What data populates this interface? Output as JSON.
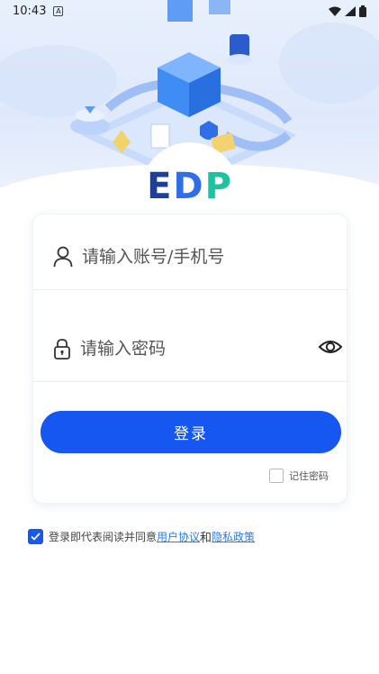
{
  "status_bar": {
    "time": "10:43",
    "notification_badge": "A"
  },
  "logo": {
    "e": "E",
    "d": "D",
    "p": "P"
  },
  "login_form": {
    "username_placeholder": "请输入账号/手机号",
    "password_placeholder": "请输入密码",
    "login_label": "登录",
    "remember_label": "记住密码"
  },
  "agreement": {
    "prefix": "登录即代表阅读并同意",
    "user_agreement": "用户协议",
    "and": "和",
    "privacy_policy": "隐私政策"
  },
  "colors": {
    "accent": "#1557f0",
    "link": "#2d7be5"
  },
  "icons": [
    "user-icon",
    "lock-icon",
    "eye-icon",
    "wifi-icon",
    "signal-icon",
    "battery-icon",
    "check-icon"
  ]
}
